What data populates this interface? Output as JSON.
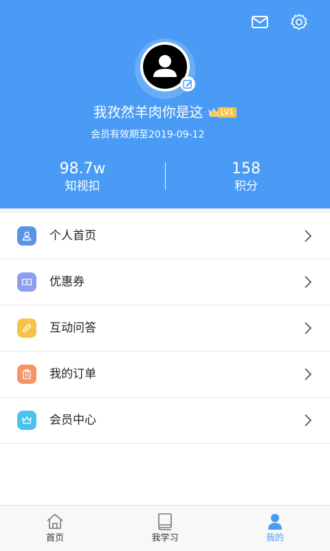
{
  "header": {
    "mail_icon": "mail-icon",
    "settings_icon": "gear-icon",
    "background_color": "#4a9bf6"
  },
  "profile": {
    "username": "我孜然羊肉你是这",
    "level": "LV1",
    "expire_text": "会员有效期至2019-09-12",
    "avatar_icon": "user-avatar-icon",
    "edit_icon": "edit-icon"
  },
  "stats": [
    {
      "value": "98.7w",
      "label": "知视扣"
    },
    {
      "value": "158",
      "label": "积分"
    }
  ],
  "menu": [
    {
      "label": "个人首页",
      "icon": "user-icon",
      "color": "#5b93e8"
    },
    {
      "label": "优惠券",
      "icon": "ticket-icon",
      "color": "#8c9ef0"
    },
    {
      "label": "互动问答",
      "icon": "pencil-icon",
      "color": "#f7c248"
    },
    {
      "label": "我的订单",
      "icon": "clipboard-icon",
      "color": "#f79365"
    },
    {
      "label": "会员中心",
      "icon": "crown-icon",
      "color": "#4cc3ef"
    }
  ],
  "tabs": [
    {
      "label": "首页",
      "icon": "home-icon",
      "active": false
    },
    {
      "label": "我学习",
      "icon": "book-icon",
      "active": false
    },
    {
      "label": "我的",
      "icon": "person-icon",
      "active": true
    }
  ],
  "accent_color": "#4a9bf6"
}
